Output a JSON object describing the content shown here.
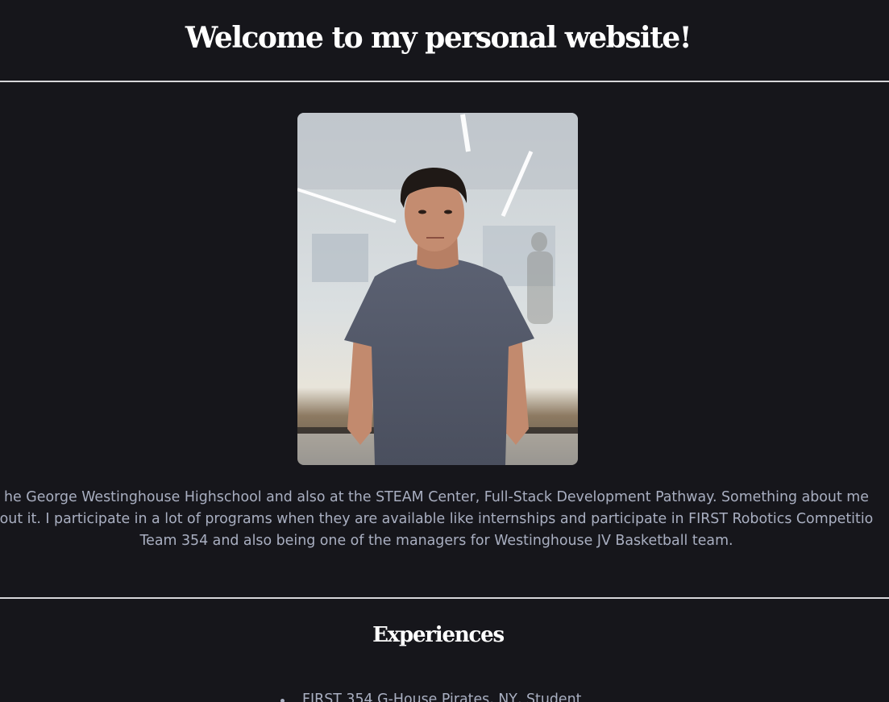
{
  "header": {
    "title": "Welcome to my personal website!"
  },
  "profile": {
    "photo_alt": "Portrait photo",
    "bio_lines": [
      "he George Westinghouse Highschool and also at the STEAM Center, Full-Stack Development Pathway. Something about me",
      "out it. I participate in a lot of programs when they are available like internships and participate in FIRST Robotics Competitio",
      "Team 354 and also being one of the managers for Westinghouse JV Basketball team."
    ]
  },
  "experiences": {
    "title": "Experiences",
    "items": [
      "FIRST 354 G-House Pirates, NY, Student"
    ]
  },
  "colors": {
    "background": "#16161b",
    "heading": "#ffffff",
    "body_text": "#a9afc1",
    "divider": "#d6d6da"
  }
}
